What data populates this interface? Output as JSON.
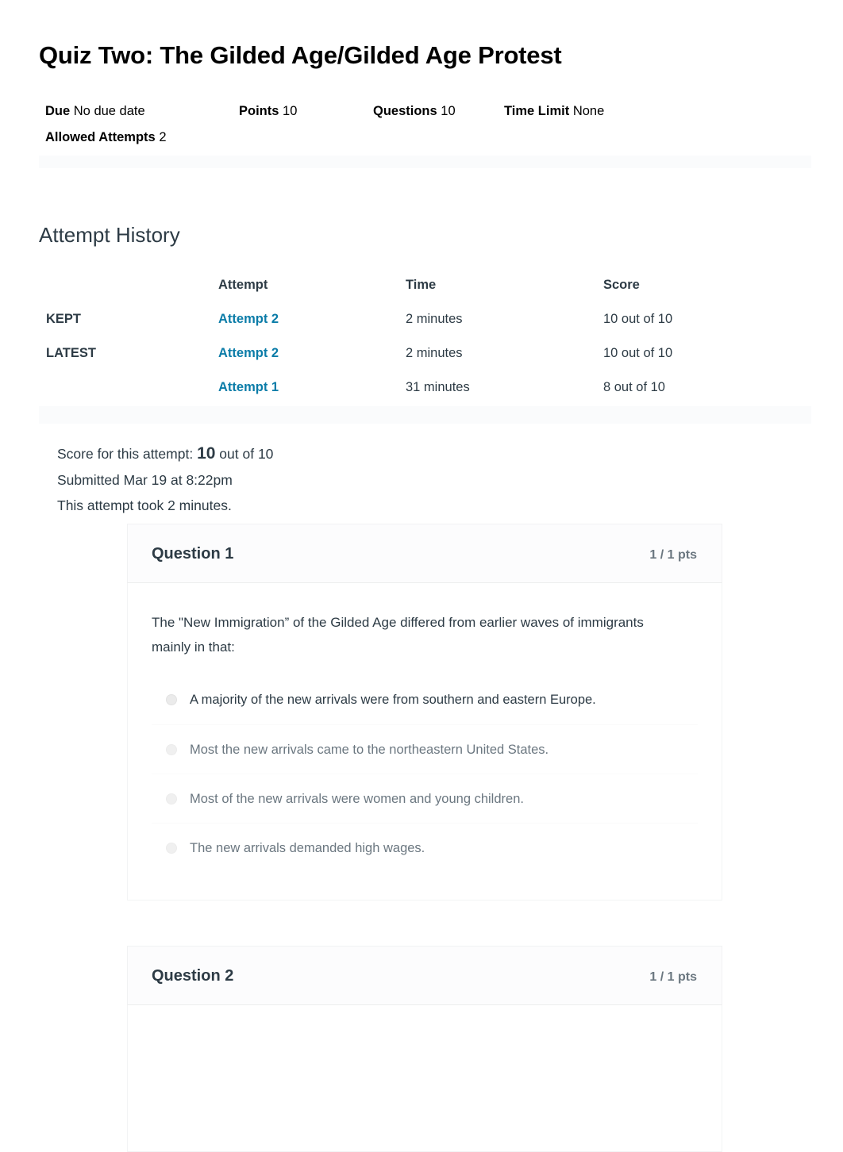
{
  "header": {
    "title": "Quiz Two: The Gilded Age/Gilded Age Protest",
    "meta": [
      {
        "label": "Due",
        "value": "No due date"
      },
      {
        "label": "Points",
        "value": "10"
      },
      {
        "label": "Questions",
        "value": "10"
      },
      {
        "label": "Time Limit",
        "value": "None"
      },
      {
        "label": "Allowed Attempts",
        "value": "2"
      }
    ]
  },
  "attempt_history": {
    "heading": "Attempt History",
    "columns": [
      "",
      "Attempt",
      "Time",
      "Score"
    ],
    "rows": [
      {
        "flag": "KEPT",
        "attempt": "Attempt 2",
        "time": "2 minutes",
        "score": "10 out of 10"
      },
      {
        "flag": "LATEST",
        "attempt": "Attempt 2",
        "time": "2 minutes",
        "score": "10 out of 10"
      },
      {
        "flag": "",
        "attempt": "Attempt 1",
        "time": "31 minutes",
        "score": "8 out of 10"
      }
    ]
  },
  "score_summary": {
    "score_prefix": "Score for this attempt:",
    "score_value": "10",
    "score_suffix": "out of 10",
    "submitted": "Submitted Mar 19 at 8:22pm",
    "duration": "This attempt took 2 minutes."
  },
  "questions": [
    {
      "name": "Question 1",
      "points": "1 / 1 pts",
      "text": "The \"New Immigration” of the Gilded Age differed from earlier waves of immigrants mainly in that:",
      "answers": [
        {
          "text": "A majority of the new arrivals were from southern and eastern Europe.",
          "selected": true
        },
        {
          "text": "Most the new arrivals came to the northeastern United States.",
          "selected": false
        },
        {
          "text": "Most of the new arrivals were women and young children.",
          "selected": false
        },
        {
          "text": "The new arrivals demanded high wages.",
          "selected": false
        }
      ]
    },
    {
      "name": "Question 2",
      "points": "1 / 1 pts",
      "text": "",
      "answers": []
    }
  ],
  "colors": {
    "link": "#0b7ca8",
    "text": "#2d3b45",
    "muted": "#6b7780",
    "band": "#fafbfc"
  }
}
